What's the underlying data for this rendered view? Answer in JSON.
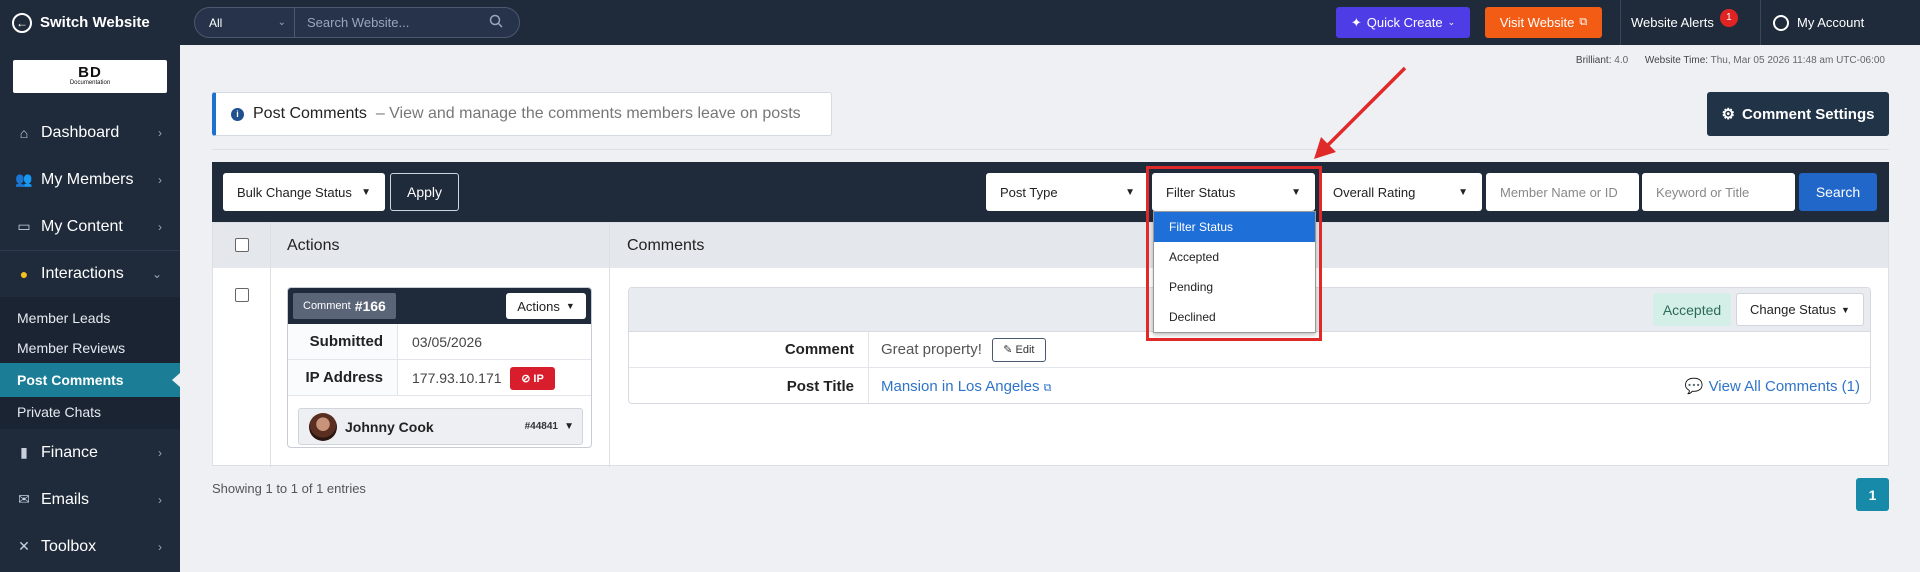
{
  "topbar": {
    "switch_label": "Switch Website",
    "search_scope": "All",
    "search_placeholder": "Search Website...",
    "quick_create": "Quick Create",
    "visit_website": "Visit Website",
    "alerts_label": "Website Alerts",
    "alerts_count": "1",
    "account_label": "My Account"
  },
  "logo": {
    "big": "BD",
    "small": "Documentation"
  },
  "sidebar": {
    "items": [
      {
        "label": "Dashboard",
        "icon": "home-icon"
      },
      {
        "label": "My Members",
        "icon": "users-icon"
      },
      {
        "label": "My Content",
        "icon": "folder-icon"
      },
      {
        "label": "Interactions",
        "icon": "chat-icon"
      },
      {
        "label": "Finance",
        "icon": "bar-chart-icon"
      },
      {
        "label": "Emails",
        "icon": "mail-icon"
      },
      {
        "label": "Toolbox",
        "icon": "tools-icon"
      }
    ],
    "sub": [
      "Member Leads",
      "Member Reviews",
      "Post Comments",
      "Private Chats"
    ]
  },
  "meta": {
    "version_label": "Brilliant:",
    "version": "4.0",
    "time_label": "Website Time:",
    "time": "Thu, Mar 05 2026 11:48 am UTC-06:00"
  },
  "header": {
    "title": "Post Comments",
    "description": "– View and manage the comments members leave on posts",
    "settings_btn": "Comment Settings"
  },
  "filters": {
    "bulk": "Bulk Change Status",
    "apply": "Apply",
    "post_type": "Post Type",
    "filter_status": "Filter Status",
    "overall_rating": "Overall Rating",
    "member_placeholder": "Member Name or ID",
    "keyword_placeholder": "Keyword or Title",
    "search": "Search"
  },
  "dropdown": {
    "options": [
      "Filter Status",
      "Accepted",
      "Pending",
      "Declined"
    ],
    "selected": "Filter Status"
  },
  "table": {
    "col_actions": "Actions",
    "col_comments": "Comments",
    "row": {
      "comment_tag": "Comment",
      "comment_num": "#166",
      "actions_btn": "Actions",
      "submitted_label": "Submitted",
      "submitted": "03/05/2026",
      "ip_label": "IP Address",
      "ip": "177.93.10.171",
      "ip_btn": "IP",
      "member_name": "Johnny Cook",
      "member_id": "#44841",
      "status": "Accepted",
      "change_status": "Change Status",
      "comment_label": "Comment",
      "comment_text": "Great property!",
      "edit_btn": "Edit",
      "post_title_label": "Post Title",
      "post_title": "Mansion in Los Angeles",
      "view_all": "View All Comments (1)"
    }
  },
  "footer": {
    "showing": "Showing 1 to 1 of 1 entries",
    "page": "1"
  },
  "colors": {
    "accent": "#1b7e96",
    "primary": "#2166c9",
    "highlight": "#e02a2a"
  }
}
